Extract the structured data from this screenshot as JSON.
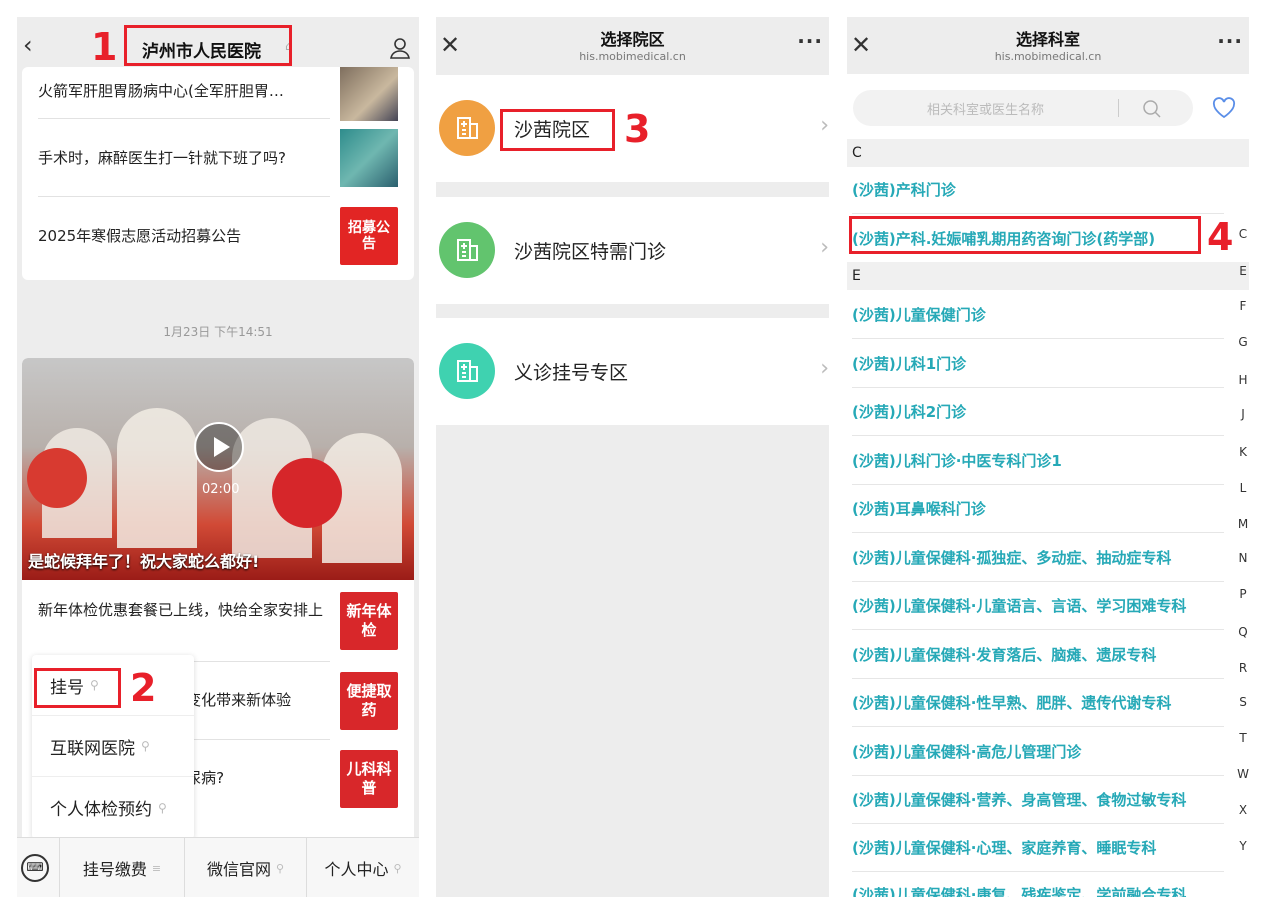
{
  "panel1": {
    "title": "泸州市人民医院",
    "news_top": [
      {
        "text": "火箭军肝胆胃肠病中心(全军肝胆胃…"
      },
      {
        "text": "手术时，麻醉医生打一针就下班了吗?"
      },
      {
        "text": "2025年寒假志愿活动招募公告",
        "tag": "招募公告"
      }
    ],
    "timestamp": "1月23日 下午14:51",
    "video": {
      "caption": "是蛇候拜年了！祝大家蛇么都好!",
      "duration": "02:00"
    },
    "news_bottom": [
      {
        "text": "新年体检优惠套餐已上线，快给全家安排上",
        "tag": "新年体检"
      },
      {
        "text": "i变化带来新体验",
        "tag": "便捷取药"
      },
      {
        "text": "i尿病?",
        "tag": "儿科科普"
      }
    ],
    "popup_menu": [
      "挂号",
      "互联网医院",
      "个人体检预约"
    ],
    "bottom_menu": [
      "挂号缴费",
      "微信官网",
      "个人中心"
    ]
  },
  "panel2": {
    "title": "选择院区",
    "subtitle": "his.mobimedical.cn",
    "areas": [
      {
        "name": "沙茜院区",
        "color": "#f0a042"
      },
      {
        "name": "沙茜院区特需门诊",
        "color": "#62c46e"
      },
      {
        "name": "义诊挂号专区",
        "color": "#3fd2b0"
      }
    ]
  },
  "panel3": {
    "title": "选择科室",
    "subtitle": "his.mobimedical.cn",
    "search_placeholder": "相关科室或医生名称",
    "sections": [
      {
        "letter": "C",
        "items": [
          "(沙茜)产科门诊",
          "(沙茜)产科.妊娠哺乳期用药咨询门诊(药学部)"
        ]
      },
      {
        "letter": "E",
        "items": [
          "(沙茜)儿童保健门诊",
          "(沙茜)儿科1门诊",
          "(沙茜)儿科2门诊",
          "(沙茜)儿科门诊·中医专科门诊1",
          "(沙茜)耳鼻喉科门诊",
          "(沙茜)儿童保健科·孤独症、多动症、抽动症专科",
          "(沙茜)儿童保健科·儿童语言、言语、学习困难专科",
          "(沙茜)儿童保健科·发育落后、脑瘫、遗尿专科",
          "(沙茜)儿童保健科·性早熟、肥胖、遗传代谢专科",
          "(沙茜)儿童保健科·高危儿管理门诊",
          "(沙茜)儿童保健科·营养、身高管理、食物过敏专科",
          "(沙茜)儿童保健科·心理、家庭养育、睡眠专科",
          "(沙茜)儿童保健科·康复、残疾鉴定、学前融合专科"
        ]
      }
    ],
    "index_letters": [
      "C",
      "E",
      "F",
      "G",
      "H",
      "J",
      "K",
      "L",
      "M",
      "N",
      "P",
      "Q",
      "R",
      "S",
      "T",
      "W",
      "X",
      "Y"
    ]
  },
  "annotations": [
    "1",
    "2",
    "3",
    "4"
  ],
  "accent_red": "#e8202a",
  "dept_color": "#26a9b7"
}
